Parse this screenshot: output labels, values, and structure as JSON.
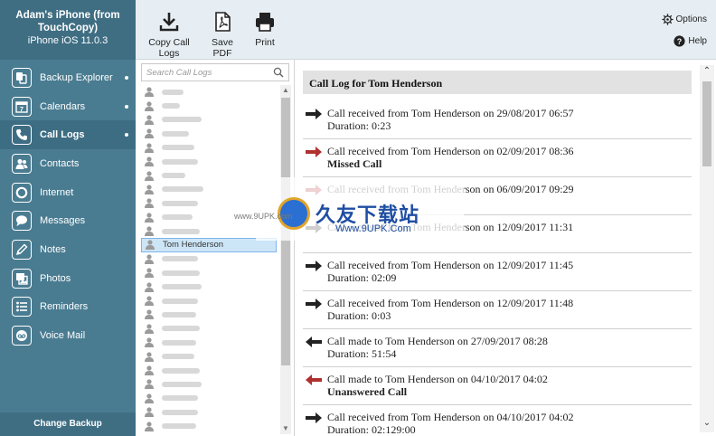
{
  "device": {
    "name": "Adam's iPhone (from TouchCopy)",
    "os": "iPhone iOS 11.0.3"
  },
  "toolbar": {
    "copy_label": "Copy Call Logs",
    "pdf_label": "Save PDF",
    "print_label": "Print",
    "options_label": "Options",
    "help_label": "Help"
  },
  "sidebar": {
    "items": [
      {
        "label": "Backup Explorer",
        "icon": "backup-explorer-icon",
        "dot": true
      },
      {
        "label": "Calendars",
        "icon": "calendar-icon",
        "dot": true
      },
      {
        "label": "Call Logs",
        "icon": "phone-icon",
        "dot": true,
        "active": true
      },
      {
        "label": "Contacts",
        "icon": "contacts-icon",
        "dot": false
      },
      {
        "label": "Internet",
        "icon": "globe-icon",
        "dot": false
      },
      {
        "label": "Messages",
        "icon": "message-icon",
        "dot": false
      },
      {
        "label": "Notes",
        "icon": "pencil-icon",
        "dot": false
      },
      {
        "label": "Photos",
        "icon": "photos-icon",
        "dot": false
      },
      {
        "label": "Reminders",
        "icon": "list-icon",
        "dot": false
      },
      {
        "label": "Voice Mail",
        "icon": "voicemail-icon",
        "dot": false
      }
    ],
    "change_backup_label": "Change Backup"
  },
  "search": {
    "placeholder": "Search Call Logs"
  },
  "contacts": {
    "selected_name": "Tom Henderson",
    "blurred_row_count": 24
  },
  "call_log": {
    "title": "Call Log for Tom Henderson",
    "entries": [
      {
        "direction": "received",
        "missed": false,
        "text": "Call received from Tom Henderson on 29/08/2017 06:57",
        "detail": "Duration: 0:23",
        "detail_bold": false
      },
      {
        "direction": "received",
        "missed": true,
        "text": "Call received from Tom Henderson on 02/09/2017 08:36",
        "detail": "Missed Call",
        "detail_bold": true
      },
      {
        "direction": "received",
        "missed": true,
        "text": "Call received from Tom Henderson on 06/09/2017 09:29",
        "detail": "",
        "detail_bold": false
      },
      {
        "direction": "received",
        "missed": false,
        "text": "Call received from Tom Henderson on 12/09/2017 11:31",
        "detail": "",
        "detail_bold": false
      },
      {
        "direction": "received",
        "missed": false,
        "text": "Call received from Tom Henderson on 12/09/2017 11:45",
        "detail": "Duration: 02:09",
        "detail_bold": false
      },
      {
        "direction": "received",
        "missed": false,
        "text": "Call received from Tom Henderson on 12/09/2017 11:48",
        "detail": "Duration: 0:03",
        "detail_bold": false
      },
      {
        "direction": "made",
        "missed": false,
        "text": "Call made to Tom Henderson on 27/09/2017 08:28",
        "detail": "Duration: 51:54",
        "detail_bold": false
      },
      {
        "direction": "made",
        "missed": true,
        "text": "Call made to Tom Henderson on 04/10/2017 04:02",
        "detail": "Unanswered Call",
        "detail_bold": true
      },
      {
        "direction": "received",
        "missed": false,
        "text": "Call received from Tom Henderson on 04/10/2017 04:02",
        "detail": "Duration: 02:129:00",
        "detail_bold": false
      }
    ]
  },
  "watermark": {
    "cn": "久友下载站",
    "en": "Www.9UPK.Com",
    "site": "www.9UPK.com"
  },
  "colors": {
    "sidebar": "#4a7c91",
    "sidebar_header": "#3f6e83",
    "toolbar": "#e6eef3",
    "missed_arrow": "#b03030",
    "normal_arrow": "#222222"
  }
}
